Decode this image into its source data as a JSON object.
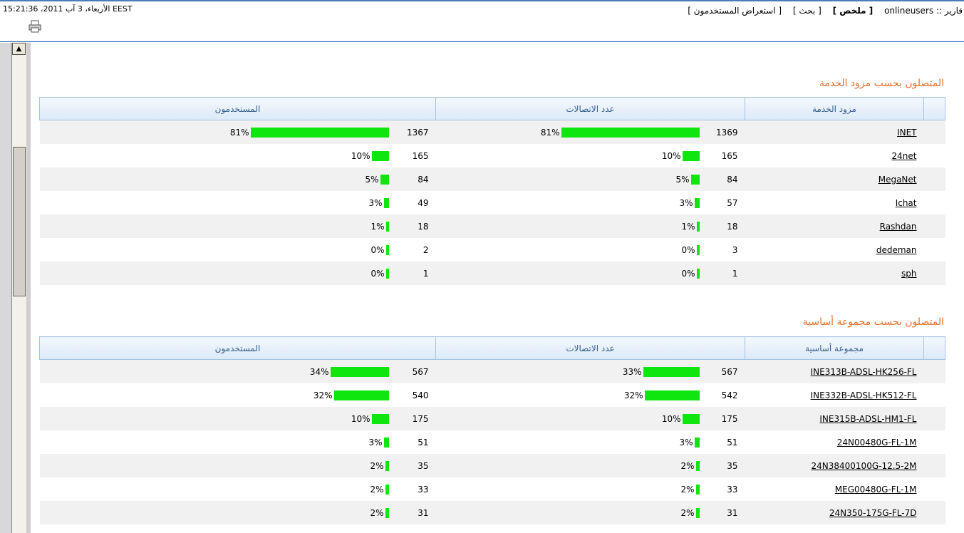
{
  "header": {
    "date": "الأربعاء، 3 آب 2011، 15:21:36 EEST",
    "nav_reports": "قارير :: onlineusers",
    "nav_summary": "[ ملخص ]",
    "nav_search": "[ بحث ]",
    "nav_view_users": "[ استعراض المستخدمون ]"
  },
  "sections": [
    {
      "title": "المتصلون بحسب مزود الخدمة",
      "col_name": "مزود الخدمة",
      "col_connections": "عدد الاتصالات",
      "col_users": "المستخدمون",
      "rows": [
        {
          "name": "INET",
          "conn": "1369",
          "conn_pct": "81%",
          "conn_frac": 0.81,
          "users": "1367",
          "users_pct": "81%",
          "users_frac": 0.81
        },
        {
          "name": "24net",
          "conn": "165",
          "conn_pct": "10%",
          "conn_frac": 0.1,
          "users": "165",
          "users_pct": "10%",
          "users_frac": 0.1
        },
        {
          "name": "MegaNet",
          "conn": "84",
          "conn_pct": "5%",
          "conn_frac": 0.05,
          "users": "84",
          "users_pct": "5%",
          "users_frac": 0.05
        },
        {
          "name": "Ichat",
          "conn": "57",
          "conn_pct": "3%",
          "conn_frac": 0.03,
          "users": "49",
          "users_pct": "3%",
          "users_frac": 0.03
        },
        {
          "name": "Rashdan",
          "conn": "18",
          "conn_pct": "1%",
          "conn_frac": 0.01,
          "users": "18",
          "users_pct": "1%",
          "users_frac": 0.01
        },
        {
          "name": "dedeman",
          "conn": "3",
          "conn_pct": "0%",
          "conn_frac": 0.003,
          "users": "2",
          "users_pct": "0%",
          "users_frac": 0.003
        },
        {
          "name": "sph",
          "conn": "1",
          "conn_pct": "0%",
          "conn_frac": 0.003,
          "users": "1",
          "users_pct": "0%",
          "users_frac": 0.003
        }
      ]
    },
    {
      "title": "المتصلون بحسب مجموعة أساسية",
      "col_name": "مجموعة أساسية",
      "col_connections": "عدد الاتصالات",
      "col_users": "المستخدمون",
      "rows": [
        {
          "name": "INE313B-ADSL-HK256-FL",
          "conn": "567",
          "conn_pct": "33%",
          "conn_frac": 0.33,
          "users": "567",
          "users_pct": "34%",
          "users_frac": 0.34
        },
        {
          "name": "INE332B-ADSL-HK512-FL",
          "conn": "542",
          "conn_pct": "32%",
          "conn_frac": 0.32,
          "users": "540",
          "users_pct": "32%",
          "users_frac": 0.32
        },
        {
          "name": "INE315B-ADSL-HM1-FL",
          "conn": "175",
          "conn_pct": "10%",
          "conn_frac": 0.1,
          "users": "175",
          "users_pct": "10%",
          "users_frac": 0.1
        },
        {
          "name": "24N00480G-FL-1M",
          "conn": "51",
          "conn_pct": "3%",
          "conn_frac": 0.03,
          "users": "51",
          "users_pct": "3%",
          "users_frac": 0.03
        },
        {
          "name": "24N38400100G-12.5-2M",
          "conn": "35",
          "conn_pct": "2%",
          "conn_frac": 0.02,
          "users": "35",
          "users_pct": "2%",
          "users_frac": 0.02
        },
        {
          "name": "MEG00480G-FL-1M",
          "conn": "33",
          "conn_pct": "2%",
          "conn_frac": 0.02,
          "users": "33",
          "users_pct": "2%",
          "users_frac": 0.02
        },
        {
          "name": "24N350-175G-FL-7D",
          "conn": "31",
          "conn_pct": "2%",
          "conn_frac": 0.02,
          "users": "31",
          "users_pct": "2%",
          "users_frac": 0.02
        }
      ]
    }
  ],
  "colors": {
    "bar": "#0fe60f",
    "section_title": "#e3702b",
    "header_text": "#3a5f8c"
  }
}
